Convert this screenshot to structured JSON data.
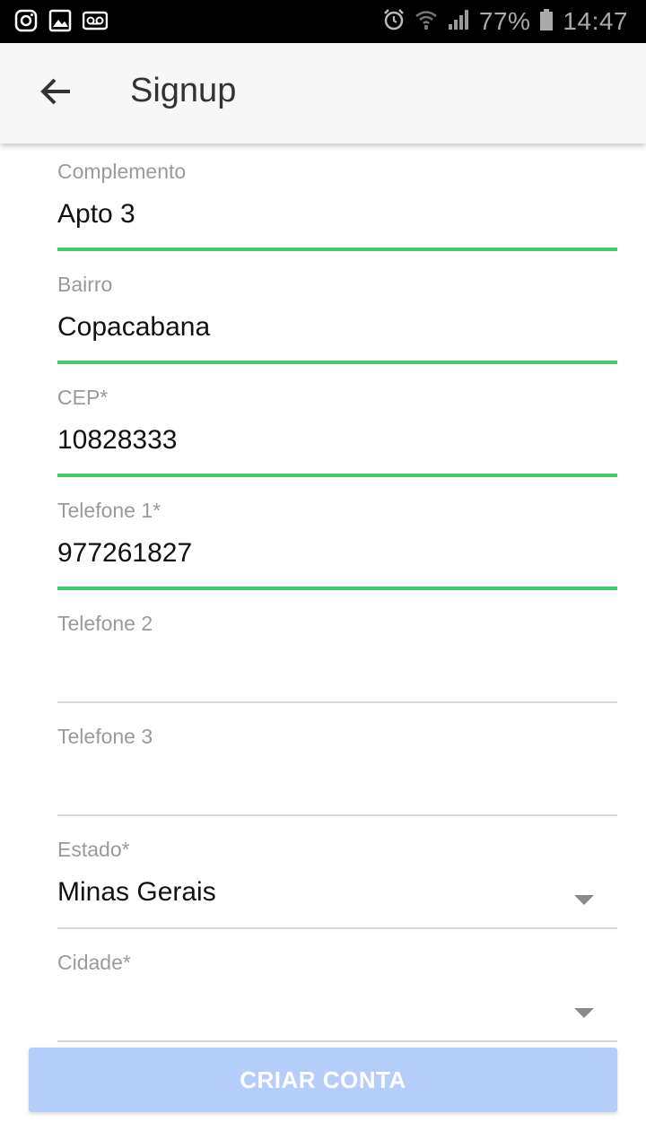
{
  "status_bar": {
    "battery": "77%",
    "time": "14:47",
    "icons": [
      "instagram-icon",
      "gallery-icon",
      "voicemail-icon",
      "alarm-icon",
      "wifi-icon",
      "signal-icon",
      "battery-icon"
    ]
  },
  "app_bar": {
    "title": "Signup",
    "back_icon": "arrow-left-icon"
  },
  "form": {
    "fields": [
      {
        "label": "Complemento",
        "value": "Apto 3",
        "state": "filled"
      },
      {
        "label": "Bairro",
        "value": "Copacabana",
        "state": "filled"
      },
      {
        "label": "CEP*",
        "value": "10828333",
        "state": "filled"
      },
      {
        "label": "Telefone 1*",
        "value": "977261827",
        "state": "filled"
      },
      {
        "label": "Telefone 2",
        "value": "",
        "state": "empty"
      },
      {
        "label": "Telefone 3",
        "value": "",
        "state": "empty"
      },
      {
        "label": "Estado*",
        "value": "Minas Gerais",
        "state": "select"
      },
      {
        "label": "Cidade*",
        "value": "",
        "state": "select"
      }
    ]
  },
  "submit": {
    "label": "CRIAR CONTA",
    "state": "disabled"
  },
  "colors": {
    "active_underline": "#45c96a",
    "inactive_underline": "#d6d6d6",
    "button_disabled": "#b4cdfa",
    "app_bar_bg": "#f7f7f7"
  }
}
